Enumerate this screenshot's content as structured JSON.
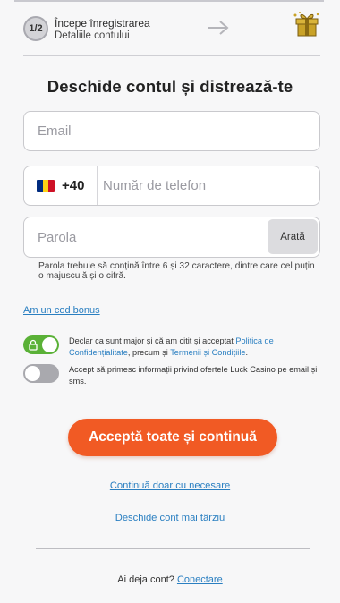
{
  "stepper": {
    "step_label": "1/2",
    "title": "Începe înregistrarea",
    "subtitle": "Detaliile contului",
    "next_icon": "arrow-right-icon",
    "reward_icon": "gift-icon"
  },
  "heading": "Deschide contul și distrează-te",
  "email": {
    "placeholder": "Email",
    "value": ""
  },
  "phone": {
    "country_flag": "Romania",
    "flag_colors": [
      "#002B7F",
      "#FCD116",
      "#CE1126"
    ],
    "prefix": "+40",
    "placeholder": "Număr de telefon",
    "value": ""
  },
  "password": {
    "placeholder": "Parola",
    "value": "",
    "show_label": "Arată",
    "hint": "Parola trebuie să conțină între 6 și 32 caractere, dintre care cel puțin o majusculă și o cifră."
  },
  "bonus_link": "Am un cod bonus",
  "consents": [
    {
      "enabled": true,
      "locked": true,
      "text_before": "Declar ca sunt major și că am citit și acceptat ",
      "link1": "Politica de Confidențialitate",
      "text_middle": ", precum și ",
      "link2": "Termenii și Condițiile",
      "text_after": "."
    },
    {
      "enabled": false,
      "text": "Accept să primesc informații privind ofertele Luck Casino pe email și sms."
    }
  ],
  "primary_button": "Acceptă toate și continuă",
  "link_necessary": "Continuă doar cu necesare",
  "link_later": "Deschide cont mai târziu",
  "login": {
    "prompt": "Ai deja cont? ",
    "link": "Conectare"
  },
  "colors": {
    "accent": "#f15a24",
    "link": "#2a7fc1",
    "toggle_on": "#5ab137",
    "toggle_off": "#a9a9ae"
  }
}
